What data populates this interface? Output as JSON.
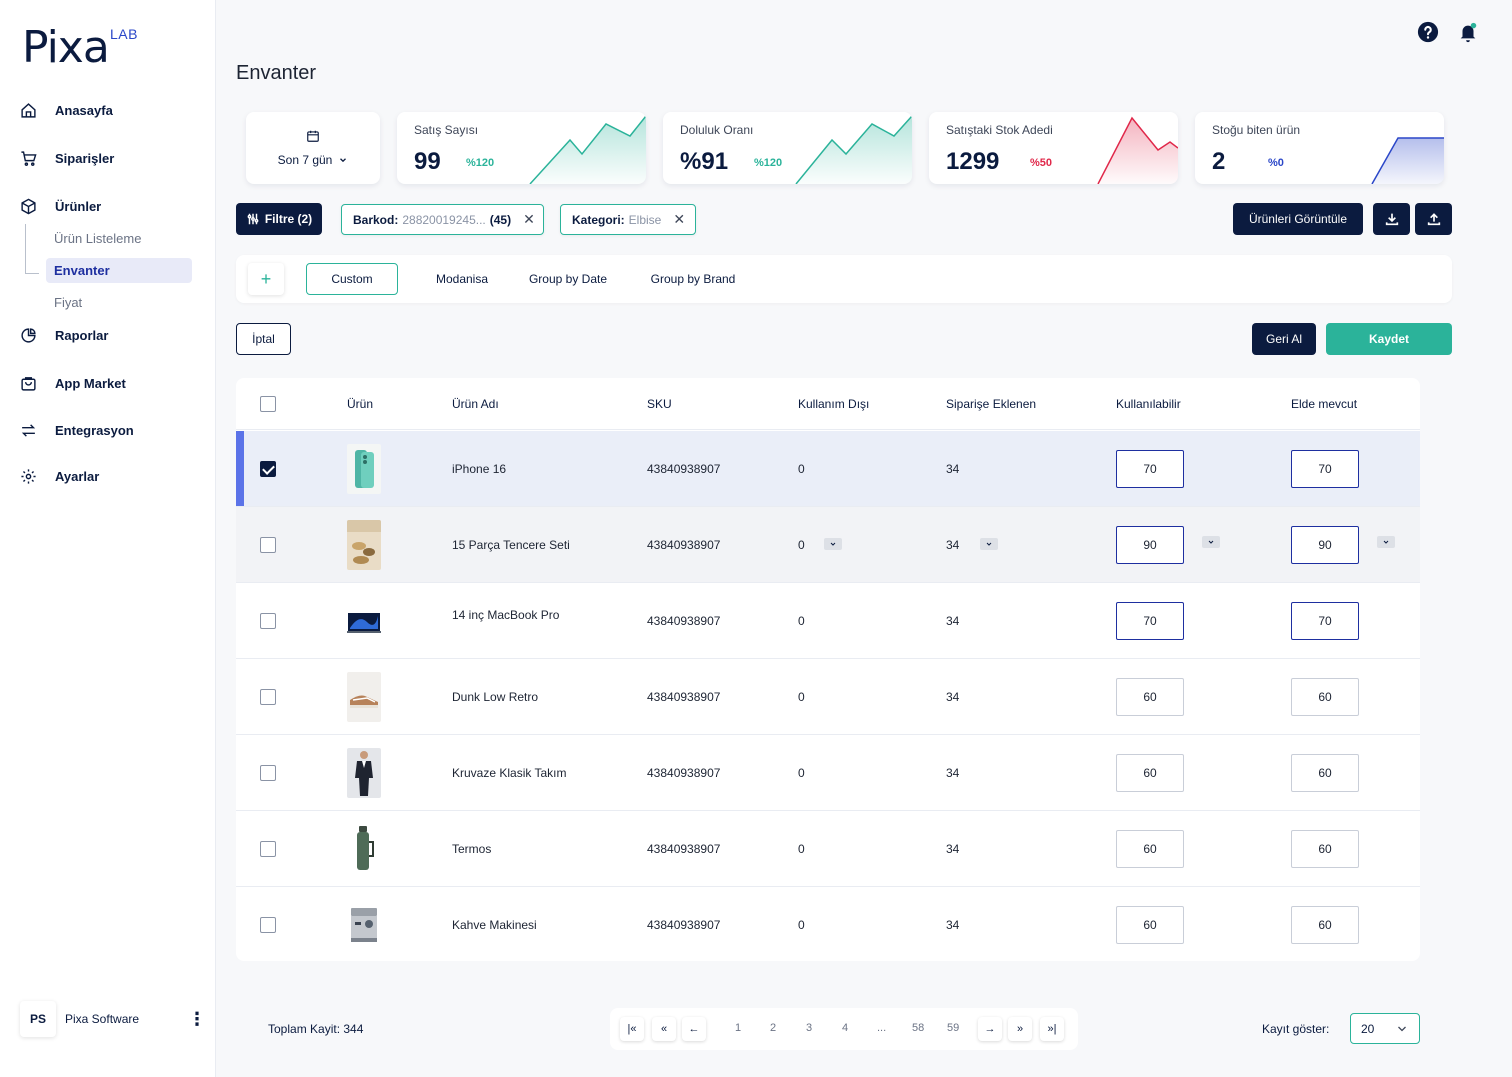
{
  "brand": {
    "name": "Pixa",
    "sup": "LAB",
    "accent": "#2BB39A",
    "dark": "#0B1B3F",
    "primary": "#1E2FA0"
  },
  "sidebar": {
    "items": [
      {
        "label": "Anasayfa",
        "icon": "home-icon"
      },
      {
        "label": "Siparişler",
        "icon": "cart-icon"
      },
      {
        "label": "Ürünler",
        "icon": "box-icon"
      },
      {
        "label": "Raporlar",
        "icon": "pie-chart-icon"
      },
      {
        "label": "App Market",
        "icon": "bag-icon"
      },
      {
        "label": "Entegrasyon",
        "icon": "sync-icon"
      },
      {
        "label": "Ayarlar",
        "icon": "gear-icon"
      }
    ],
    "sub_items": [
      "Ürün Listeleme",
      "Envanter",
      "Fiyat"
    ],
    "user": {
      "initials": "PS",
      "name": "Pixa Software"
    }
  },
  "page_title": "Envanter",
  "date_filter": "Son 7 gün",
  "stats": [
    {
      "label": "Satış Sayısı",
      "value": "99",
      "delta": "%120",
      "color": "#2BB39A"
    },
    {
      "label": "Doluluk Oranı",
      "value": "%91",
      "delta": "%120",
      "color": "#2BB39A"
    },
    {
      "label": "Satıştaki Stok Adedi",
      "value": "1299",
      "delta": "%50",
      "color": "#E0284A"
    },
    {
      "label": "Stoğu biten ürün",
      "value": "2",
      "delta": "%0",
      "color": "#2B47C8"
    }
  ],
  "filters": {
    "button": "Filtre (2)",
    "chips": [
      {
        "key": "Barkod:",
        "value": "28820019245...",
        "count": "(45)"
      },
      {
        "key": "Kategori:",
        "value": "Elbise",
        "count": ""
      }
    ],
    "view_button": "Ürünleri Görüntüle"
  },
  "tabs": {
    "add": "+",
    "items": [
      "Custom",
      "Modanisa",
      "Group by Date",
      "Group by Brand"
    ]
  },
  "actions": {
    "cancel": "İptal",
    "undo": "Geri Al",
    "save": "Kaydet"
  },
  "table": {
    "headers": [
      "Ürün",
      "Ürün Adı",
      "SKU",
      "Kullanım Dışı",
      "Siparişe Eklenen",
      "Kullanılabilir",
      "Elde mevcut"
    ],
    "rows": [
      {
        "name": "iPhone 16",
        "sku": "43840938907",
        "disabled": "0",
        "ordered": "34",
        "available": "70",
        "on_hand": "70",
        "checked": true
      },
      {
        "name": "15 Parça Tencere Seti",
        "sku": "43840938907",
        "disabled": "0",
        "ordered": "34",
        "available": "90",
        "on_hand": "90",
        "checked": false
      },
      {
        "name": "14 inç MacBook Pro",
        "sku": "43840938907",
        "disabled": "0",
        "ordered": "34",
        "available": "70",
        "on_hand": "70",
        "checked": false
      },
      {
        "name": "Dunk Low Retro",
        "sku": "43840938907",
        "disabled": "0",
        "ordered": "34",
        "available": "60",
        "on_hand": "60",
        "checked": false
      },
      {
        "name": "Kruvaze Klasik Takım",
        "sku": "43840938907",
        "disabled": "0",
        "ordered": "34",
        "available": "60",
        "on_hand": "60",
        "checked": false
      },
      {
        "name": "Termos",
        "sku": "43840938907",
        "disabled": "0",
        "ordered": "34",
        "available": "60",
        "on_hand": "60",
        "checked": false
      },
      {
        "name": "Kahve Makinesi",
        "sku": "43840938907",
        "disabled": "0",
        "ordered": "34",
        "available": "60",
        "on_hand": "60",
        "checked": false
      }
    ]
  },
  "pagination": {
    "total": "Toplam Kayit: 344",
    "pages": [
      "1",
      "2",
      "3",
      "4",
      "...",
      "58",
      "59"
    ],
    "show_label": "Kayıt göster:",
    "page_size": "20"
  }
}
